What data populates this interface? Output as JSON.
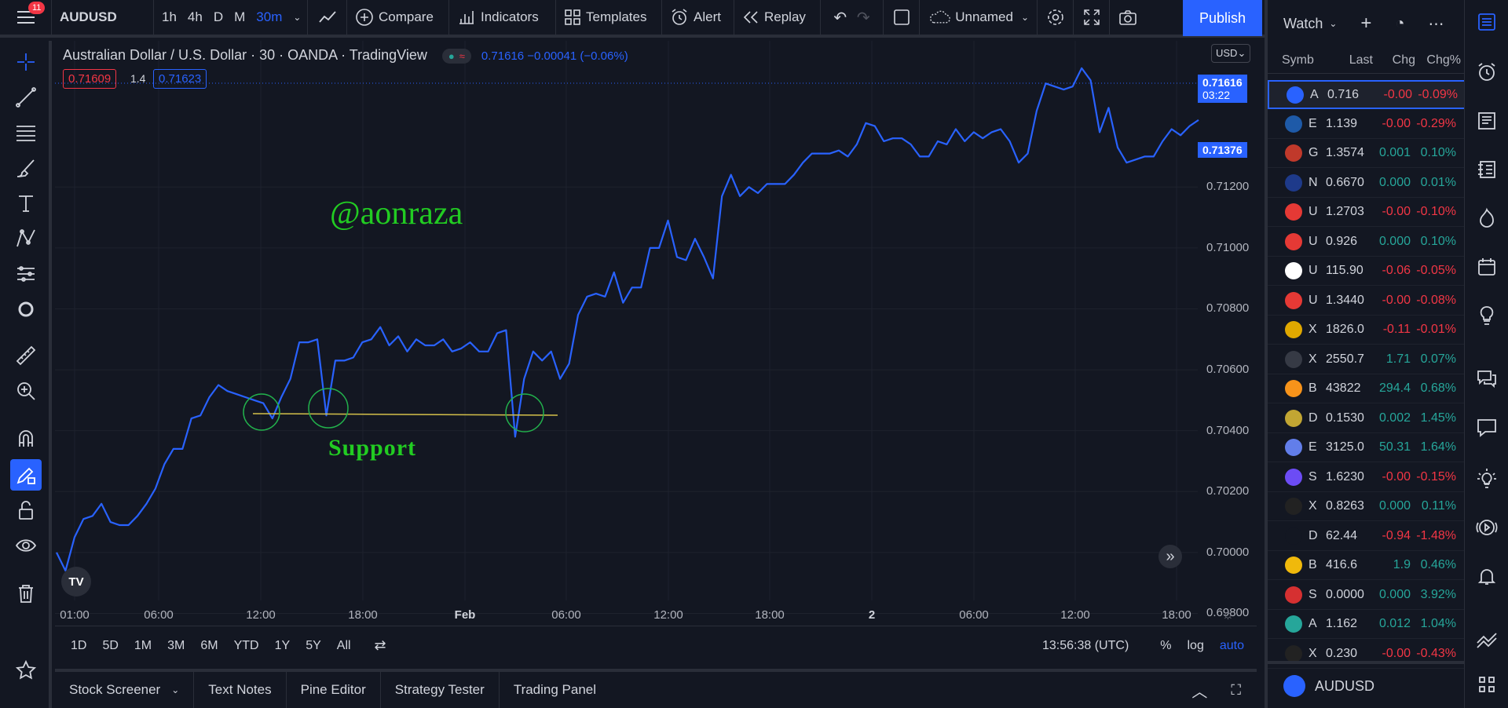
{
  "toolbar": {
    "notification_count": "11",
    "symbol": "AUDUSD",
    "timeframes": [
      "1h",
      "4h",
      "D",
      "M",
      "30m"
    ],
    "active_timeframe": "30m",
    "compare": "Compare",
    "indicators": "Indicators",
    "templates": "Templates",
    "alert": "Alert",
    "replay": "Replay",
    "layout_name": "Unnamed",
    "publish": "Publish"
  },
  "legend": {
    "title": "Australian Dollar / U.S. Dollar · 30 · OANDA · TradingView",
    "change": "0.71616 −0.00041 (−0.06%)",
    "bid": "0.71609",
    "spread": "1.4",
    "ask": "0.71623",
    "currency": "USD"
  },
  "annotations": {
    "author": "@aonraza",
    "support": "Support"
  },
  "price_labels": {
    "last": "0.71616",
    "countdown": "03:22",
    "other": "0.71376"
  },
  "axis": {
    "y_ticks": [
      "0.71200",
      "0.71000",
      "0.70800",
      "0.70600",
      "0.70400",
      "0.70200",
      "0.70000",
      "0.69800"
    ],
    "x_ticks": [
      "01:00",
      "06:00",
      "12:00",
      "18:00",
      "Feb",
      "06:00",
      "12:00",
      "18:00",
      "2",
      "06:00",
      "12:00",
      "18:00"
    ]
  },
  "chart_data": {
    "type": "line",
    "ylim": [
      0.6976,
      0.7168
    ],
    "y_values": [
      0.7,
      0.6994,
      0.7005,
      0.7011,
      0.7012,
      0.7016,
      0.701,
      0.7009,
      0.7009,
      0.7012,
      0.7016,
      0.7021,
      0.7029,
      0.7034,
      0.7034,
      0.7044,
      0.7045,
      0.7051,
      0.7055,
      0.7053,
      0.7052,
      0.7051,
      0.705,
      0.7049,
      0.7044,
      0.7051,
      0.7057,
      0.7069,
      0.7069,
      0.707,
      0.7045,
      0.7063,
      0.7063,
      0.7064,
      0.7069,
      0.707,
      0.7074,
      0.7068,
      0.7071,
      0.7066,
      0.707,
      0.7068,
      0.7068,
      0.707,
      0.7066,
      0.7067,
      0.7069,
      0.7066,
      0.7066,
      0.7072,
      0.7073,
      0.7038,
      0.7057,
      0.7066,
      0.7063,
      0.7066,
      0.7057,
      0.7062,
      0.7078,
      0.7084,
      0.7085,
      0.7084,
      0.7092,
      0.7082,
      0.7087,
      0.7087,
      0.71,
      0.71,
      0.7109,
      0.7097,
      0.7096,
      0.7103,
      0.7097,
      0.709,
      0.7117,
      0.7124,
      0.7117,
      0.712,
      0.7118,
      0.7121,
      0.7121,
      0.7121,
      0.7124,
      0.7128,
      0.7131,
      0.7131,
      0.7131,
      0.7132,
      0.713,
      0.7134,
      0.7141,
      0.714,
      0.7135,
      0.7136,
      0.7136,
      0.7134,
      0.713,
      0.713,
      0.7135,
      0.7134,
      0.7139,
      0.7135,
      0.7138,
      0.7136,
      0.7138,
      0.7139,
      0.7135,
      0.7128,
      0.7131,
      0.7145,
      0.7154,
      0.7153,
      0.7152,
      0.7153,
      0.7159,
      0.7155,
      0.7138,
      0.7146,
      0.7133,
      0.7128,
      0.7129,
      0.713,
      0.713,
      0.7135,
      0.7139,
      0.7137,
      0.714,
      0.7142
    ]
  },
  "bottom": {
    "ranges": [
      "1D",
      "5D",
      "1M",
      "3M",
      "6M",
      "YTD",
      "1Y",
      "5Y",
      "All"
    ],
    "time": "13:56:38 (UTC)",
    "pct": "%",
    "log": "log",
    "auto": "auto"
  },
  "tabs": [
    "Stock Screener",
    "Text Notes",
    "Pine Editor",
    "Strategy Tester",
    "Trading Panel"
  ],
  "watchlist": {
    "title": "Watch",
    "columns": [
      "Symb",
      "Last",
      "Chg",
      "Chg%"
    ],
    "rows": [
      {
        "s": "A",
        "last": "0.716",
        "chg": "-0.00",
        "pct": "-0.09%",
        "dir": "neg",
        "color": "#2962ff"
      },
      {
        "s": "E",
        "last": "1.139",
        "chg": "-0.00",
        "pct": "-0.29%",
        "dir": "neg",
        "color": "#1e5aa8"
      },
      {
        "s": "G",
        "last": "1.3574",
        "chg": "0.001",
        "pct": "0.10%",
        "dir": "pos",
        "color": "#c0392b"
      },
      {
        "s": "N",
        "last": "0.6670",
        "chg": "0.000",
        "pct": "0.01%",
        "dir": "pos",
        "color": "#1e3a8a"
      },
      {
        "s": "U",
        "last": "1.2703",
        "chg": "-0.00",
        "pct": "-0.10%",
        "dir": "neg",
        "color": "#e53935"
      },
      {
        "s": "U",
        "last": "0.926",
        "chg": "0.000",
        "pct": "0.10%",
        "dir": "pos",
        "color": "#e53935"
      },
      {
        "s": "U",
        "last": "115.90",
        "chg": "-0.06",
        "pct": "-0.05%",
        "dir": "neg",
        "color": "#ffffff"
      },
      {
        "s": "U",
        "last": "1.3440",
        "chg": "-0.00",
        "pct": "-0.08%",
        "dir": "neg",
        "color": "#e53935"
      },
      {
        "s": "X",
        "last": "1826.0",
        "chg": "-0.11",
        "pct": "-0.01%",
        "dir": "neg",
        "color": "#e0a800"
      },
      {
        "s": "X",
        "last": "2550.7",
        "chg": "1.71",
        "pct": "0.07%",
        "dir": "pos",
        "color": "#363a45"
      },
      {
        "s": "B",
        "last": "43822",
        "chg": "294.4",
        "pct": "0.68%",
        "dir": "pos",
        "color": "#f7931a"
      },
      {
        "s": "D",
        "last": "0.1530",
        "chg": "0.002",
        "pct": "1.45%",
        "dir": "pos",
        "color": "#c2a633"
      },
      {
        "s": "E",
        "last": "3125.0",
        "chg": "50.31",
        "pct": "1.64%",
        "dir": "pos",
        "color": "#627eea"
      },
      {
        "s": "S",
        "last": "1.6230",
        "chg": "-0.00",
        "pct": "-0.15%",
        "dir": "neg",
        "color": "#6c4cf5"
      },
      {
        "s": "X",
        "last": "0.8263",
        "chg": "0.000",
        "pct": "0.11%",
        "dir": "pos",
        "color": "#222222"
      },
      {
        "s": "D",
        "last": "62.44",
        "chg": "-0.94",
        "pct": "-1.48%",
        "dir": "neg",
        "color": "#131722"
      },
      {
        "s": "B",
        "last": "416.6",
        "chg": "1.9",
        "pct": "0.46%",
        "dir": "pos",
        "color": "#f0b90b"
      },
      {
        "s": "S",
        "last": "0.0000",
        "chg": "0.000",
        "pct": "3.92%",
        "dir": "pos",
        "color": "#d63031"
      },
      {
        "s": "A",
        "last": "1.162",
        "chg": "0.012",
        "pct": "1.04%",
        "dir": "pos",
        "color": "#26a69a"
      },
      {
        "s": "X",
        "last": "0.230",
        "chg": "-0.00",
        "pct": "-0.43%",
        "dir": "neg",
        "color": "#222222"
      }
    ],
    "footer": "AUDUSD"
  }
}
